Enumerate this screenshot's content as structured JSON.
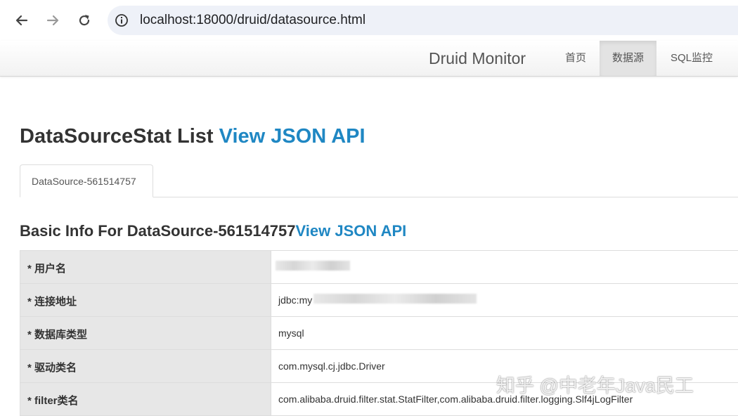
{
  "browser": {
    "url": "localhost:18000/druid/datasource.html"
  },
  "navbar": {
    "brand": "Druid Monitor",
    "items": [
      {
        "label": "首页",
        "active": false
      },
      {
        "label": "数据源",
        "active": true
      },
      {
        "label": "SQL监控",
        "active": false
      }
    ]
  },
  "main": {
    "title": "DataSourceStat List ",
    "title_link": "View JSON API",
    "tab_label": "DataSource-561514757",
    "basic_title": "Basic Info For DataSource-561514757",
    "basic_link": "View JSON API"
  },
  "table": {
    "rows": [
      {
        "key": "* 用户名",
        "value": ""
      },
      {
        "key": "* 连接地址",
        "value": "jdbc:my"
      },
      {
        "key": "* 数据库类型",
        "value": "mysql"
      },
      {
        "key": "* 驱动类名",
        "value": "com.mysql.cj.jdbc.Driver"
      },
      {
        "key": "* filter类名",
        "value": "com.alibaba.druid.filter.stat.StatFilter,com.alibaba.druid.filter.logging.Slf4jLogFilter"
      }
    ]
  },
  "watermark": "知乎 @中老年Java民工",
  "colors": {
    "link": "#1f87c3",
    "key_bg": "#e7e7e7"
  }
}
